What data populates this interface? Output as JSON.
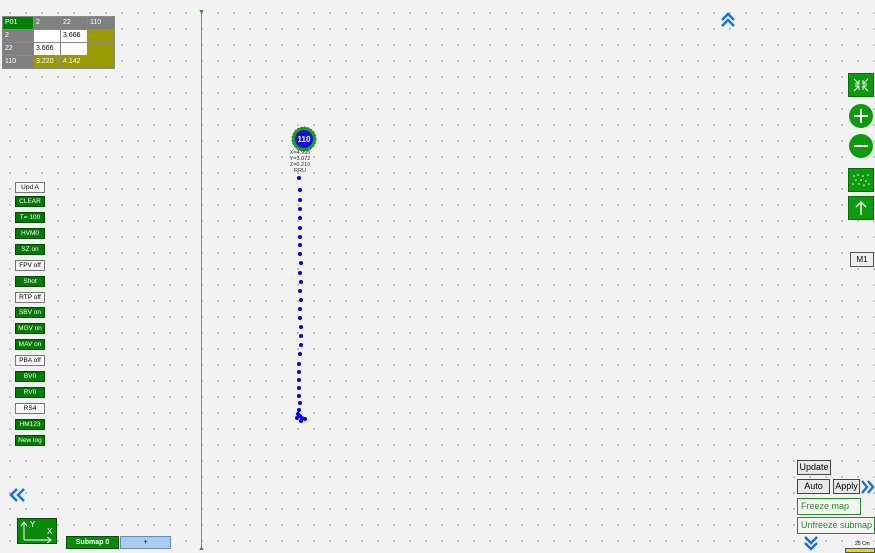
{
  "table": {
    "header": [
      "P01",
      "2",
      "22",
      "110"
    ],
    "rows": [
      [
        "2",
        "",
        "3.666",
        ""
      ],
      [
        "22",
        "3.666",
        "",
        ""
      ],
      [
        "110",
        "3.220",
        "4.142",
        ""
      ]
    ]
  },
  "left_buttons": [
    {
      "label": "Upd A",
      "style": "white"
    },
    {
      "label": "CLEAR",
      "style": "green"
    },
    {
      "label": "T= 100",
      "style": "green"
    },
    {
      "label": "HVM0",
      "style": "green"
    },
    {
      "label": "SZ on",
      "style": "green"
    },
    {
      "label": "FPV off",
      "style": "white"
    },
    {
      "label": "Shot",
      "style": "green"
    },
    {
      "label": "RTP off",
      "style": "white"
    },
    {
      "label": "SBV on",
      "style": "green"
    },
    {
      "label": "MGV on",
      "style": "green"
    },
    {
      "label": "MAV on",
      "style": "green"
    },
    {
      "label": "PBA off",
      "style": "white"
    },
    {
      "label": "BV0",
      "style": "green"
    },
    {
      "label": "RV0",
      "style": "green"
    },
    {
      "label": "RS4",
      "style": "white"
    },
    {
      "label": "HM123",
      "style": "green"
    },
    {
      "label": "New log",
      "style": "green"
    }
  ],
  "node": {
    "label": "110",
    "info": [
      "X=4.995",
      "Y=3.072",
      "Z=0.210",
      "RRU"
    ]
  },
  "right_panel": {
    "m1_label": "M1",
    "update_label": "Update",
    "auto_label": "Auto",
    "apply_label": "Apply",
    "freeze_label": "Freeze map",
    "unfreeze_label": "Unfreeze submap",
    "scale_label": "25 Cm"
  },
  "bottom": {
    "submap_label": "Submap 0",
    "add_label": "+",
    "axis_y": "Y",
    "axis_x": "X"
  },
  "icons": {
    "top_chevron": "double-chevron-up-icon",
    "bottom_chevron": "double-chevron-down-icon",
    "left_chevron": "double-chevron-left-icon",
    "right_chevron": "double-chevron-right-icon",
    "tools": [
      "fit-view-icon",
      "zoom-in-icon",
      "zoom-out-icon",
      "point-cloud-icon",
      "up-arrow-icon"
    ]
  },
  "colors": {
    "accent_green": "#0c9b0c",
    "path_blue": "#0000ee",
    "chevron_blue": "#1a6fe0"
  }
}
